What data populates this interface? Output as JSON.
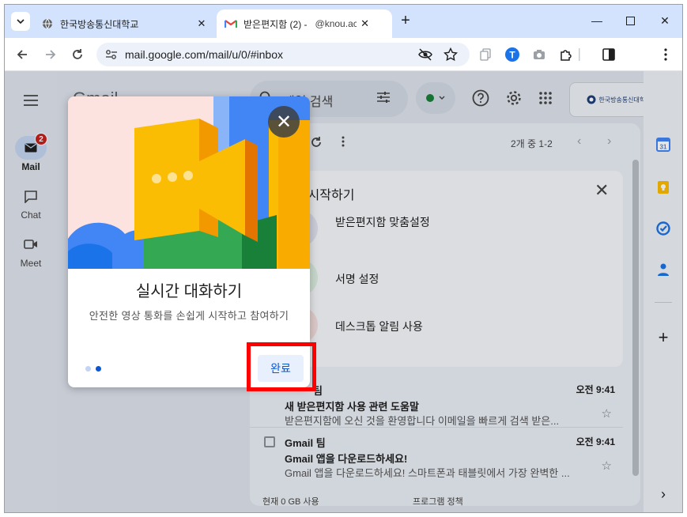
{
  "browser": {
    "tabs": [
      {
        "title": "한국방송통신대학교",
        "favicon": "globe-icon"
      },
      {
        "title": "받은편지함 (2) -",
        "sub": "@knou.ac.kr",
        "favicon": "gmail-icon"
      }
    ],
    "url": "mail.google.com/mail/u/0/#inbox"
  },
  "gmail": {
    "logo": "Gmail",
    "search_placeholder": "메일 검색",
    "org_logo_text": "한국방송통신대학교",
    "rail": {
      "mail_label": "Mail",
      "mail_badge": "2",
      "chat_label": "Chat",
      "meet_label": "Meet"
    },
    "toolbar": {
      "count": "2개 중 1-2"
    },
    "setup": {
      "title": "il 시작하기",
      "items": [
        "받은편지함 맞춤설정",
        "서명 설정",
        "데스크톱 알림 사용"
      ]
    },
    "emails": [
      {
        "sender": "팀",
        "time": "오전 9:41",
        "subject": "새 받은편지함 사용 관련 도움말",
        "snippet": "받은편지함에 오신 것을 환영합니다 이메일을 빠르게 검색 받은..."
      },
      {
        "sender": "Gmail 팀",
        "time": "오전 9:41",
        "subject": "Gmail 앱을 다운로드하세요!",
        "snippet": "Gmail 앱을 다운로드하세요! 스마트폰과 태블릿에서 가장 완벽한 ..."
      }
    ],
    "footer": {
      "storage": "현재 0 GB 사용",
      "policy": "프로그램 정책"
    }
  },
  "onboarding": {
    "title": "실시간 대화하기",
    "description": "안전한 영상 통화를 손쉽게 시작하고 참여하기",
    "done_label": "완료",
    "page": 2,
    "pages": 2
  },
  "colors": {
    "accent": "#0b57d0",
    "highlight": "#ff0000",
    "badge": "#c5221f"
  }
}
